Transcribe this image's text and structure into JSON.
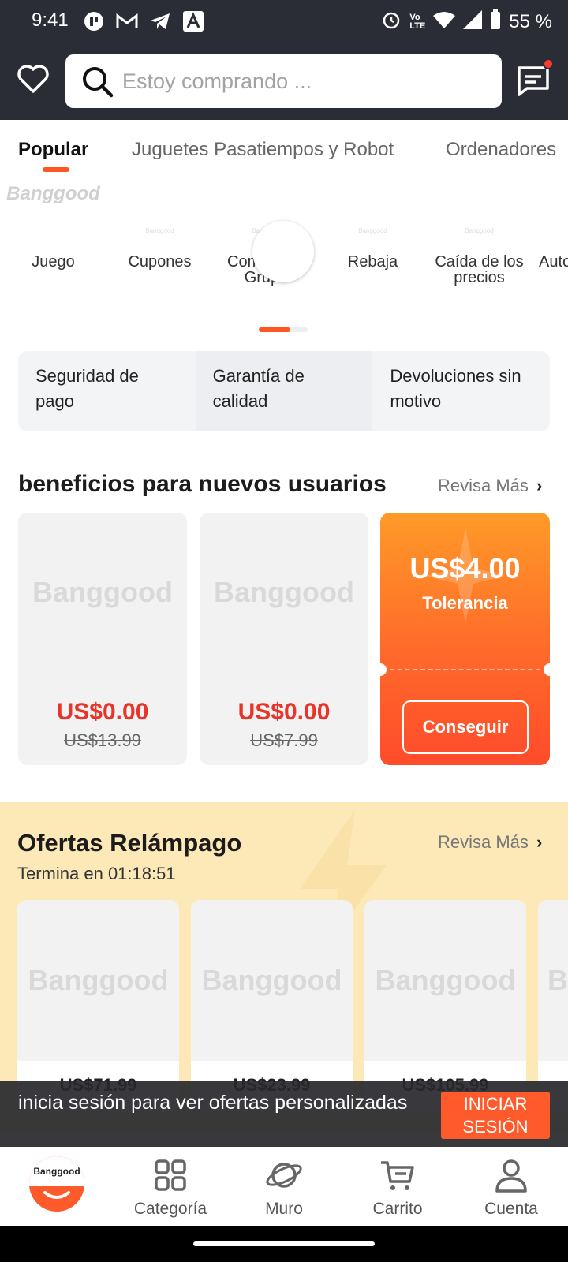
{
  "status_bar": {
    "time": "9:41",
    "battery": "55 %",
    "left_icons": [
      "app-icon",
      "gmail-icon",
      "telegram-icon",
      "android-auto-icon"
    ],
    "right_icons": [
      "alarm-icon",
      "volte-icon",
      "wifi-icon",
      "signal-icon",
      "battery-icon"
    ]
  },
  "header": {
    "search_placeholder": "Estoy comprando ..."
  },
  "tabs": [
    {
      "label": "Popular",
      "active": true
    },
    {
      "label": "Juguetes Pasatiempos y Robot",
      "active": false
    },
    {
      "label": "Ordenadores",
      "active": false
    }
  ],
  "brand_logo_text": "Banggood",
  "quick_categories": [
    {
      "label": "Juego"
    },
    {
      "label": "Cupones"
    },
    {
      "label": "Compra de Grupo"
    },
    {
      "label": "Rebaja"
    },
    {
      "label": "Caída de los precios"
    },
    {
      "label": "Auto"
    }
  ],
  "carousel_indicator_progress": 0.65,
  "guarantees": [
    "Seguridad de pago",
    "Garantía de calidad",
    "Devoluciones sin motivo"
  ],
  "new_user": {
    "title": "beneficios para nuevos usuarios",
    "more": "Revisa Más",
    "products": [
      {
        "price": "US$0.00",
        "original": "US$13.99"
      },
      {
        "price": "US$0.00",
        "original": "US$7.99"
      }
    ],
    "coupon": {
      "amount": "US$4.00",
      "label": "Tolerancia",
      "button": "Conseguir"
    }
  },
  "flash_deals": {
    "title": "Ofertas Relámpago",
    "timer": "Termina en 01:18:51",
    "more": "Revisa Más",
    "products": [
      {
        "price": "US$71.99"
      },
      {
        "price": "US$23.99"
      },
      {
        "price": "US$105.99"
      }
    ]
  },
  "login_banner": {
    "text": "inicia sesión para ver ofertas personalizadas",
    "button": "INICIAR SESIÓN"
  },
  "bottom_nav": [
    {
      "label": "Categoría",
      "icon": "grid-icon"
    },
    {
      "label": "Muro",
      "icon": "planet-icon"
    },
    {
      "label": "Carrito",
      "icon": "cart-icon"
    },
    {
      "label": "Cuenta",
      "icon": "user-icon"
    }
  ],
  "colors": {
    "accent": "#ff5722",
    "header_bg": "#2b2d36",
    "price_red": "#e8352a",
    "flash_bg": "#fde9b8"
  }
}
